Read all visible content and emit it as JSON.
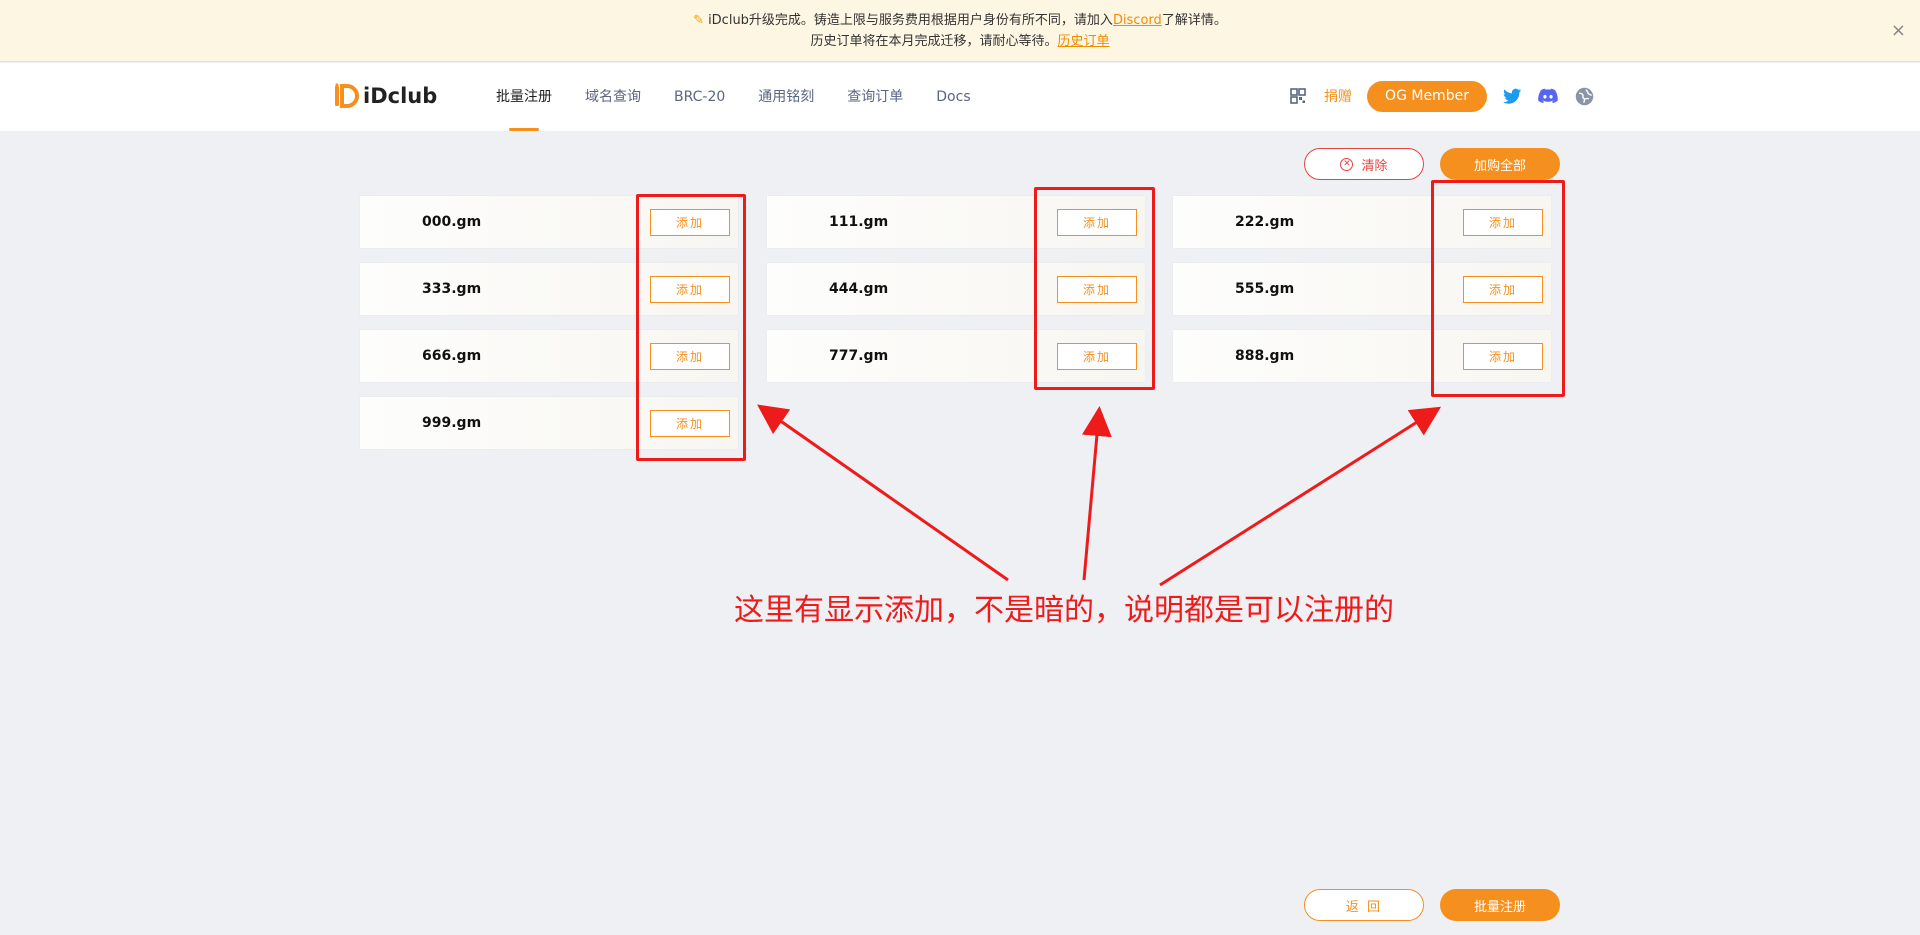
{
  "notice": {
    "line1_prefix": "iDclub升级完成。铸造上限与服务费用根据用户身份有所不同，请加入",
    "line1_link": "Discord",
    "line1_suffix": "了解详情。",
    "line2_prefix": "历史订单将在本月完成迁移，请耐心等待。",
    "line2_link": "历史订单",
    "close": "×"
  },
  "header": {
    "logo_text": "iDclub",
    "nav": [
      {
        "label": "批量注册",
        "active": true
      },
      {
        "label": "域名查询",
        "active": false
      },
      {
        "label": "BRC-20",
        "active": false
      },
      {
        "label": "通用铭刻",
        "active": false
      },
      {
        "label": "查询订单",
        "active": false
      },
      {
        "label": "Docs",
        "active": false
      }
    ],
    "donate": "捐赠",
    "og_member": "OG Member"
  },
  "actions": {
    "clear": "清除",
    "add_all": "加购全部",
    "back": "返 回",
    "batch_register": "批量注册"
  },
  "domains": [
    {
      "name": "000.gm",
      "add": "添加"
    },
    {
      "name": "111.gm",
      "add": "添加"
    },
    {
      "name": "222.gm",
      "add": "添加"
    },
    {
      "name": "333.gm",
      "add": "添加"
    },
    {
      "name": "444.gm",
      "add": "添加"
    },
    {
      "name": "555.gm",
      "add": "添加"
    },
    {
      "name": "666.gm",
      "add": "添加"
    },
    {
      "name": "777.gm",
      "add": "添加"
    },
    {
      "name": "888.gm",
      "add": "添加"
    },
    {
      "name": "999.gm",
      "add": "添加"
    }
  ],
  "annotation": {
    "text": "这里有显示添加，不是暗的，说明都是可以注册的",
    "color": "#ee1b1b"
  },
  "colors": {
    "accent": "#f5901f",
    "danger": "#e64340",
    "background": "#eff0f4"
  }
}
